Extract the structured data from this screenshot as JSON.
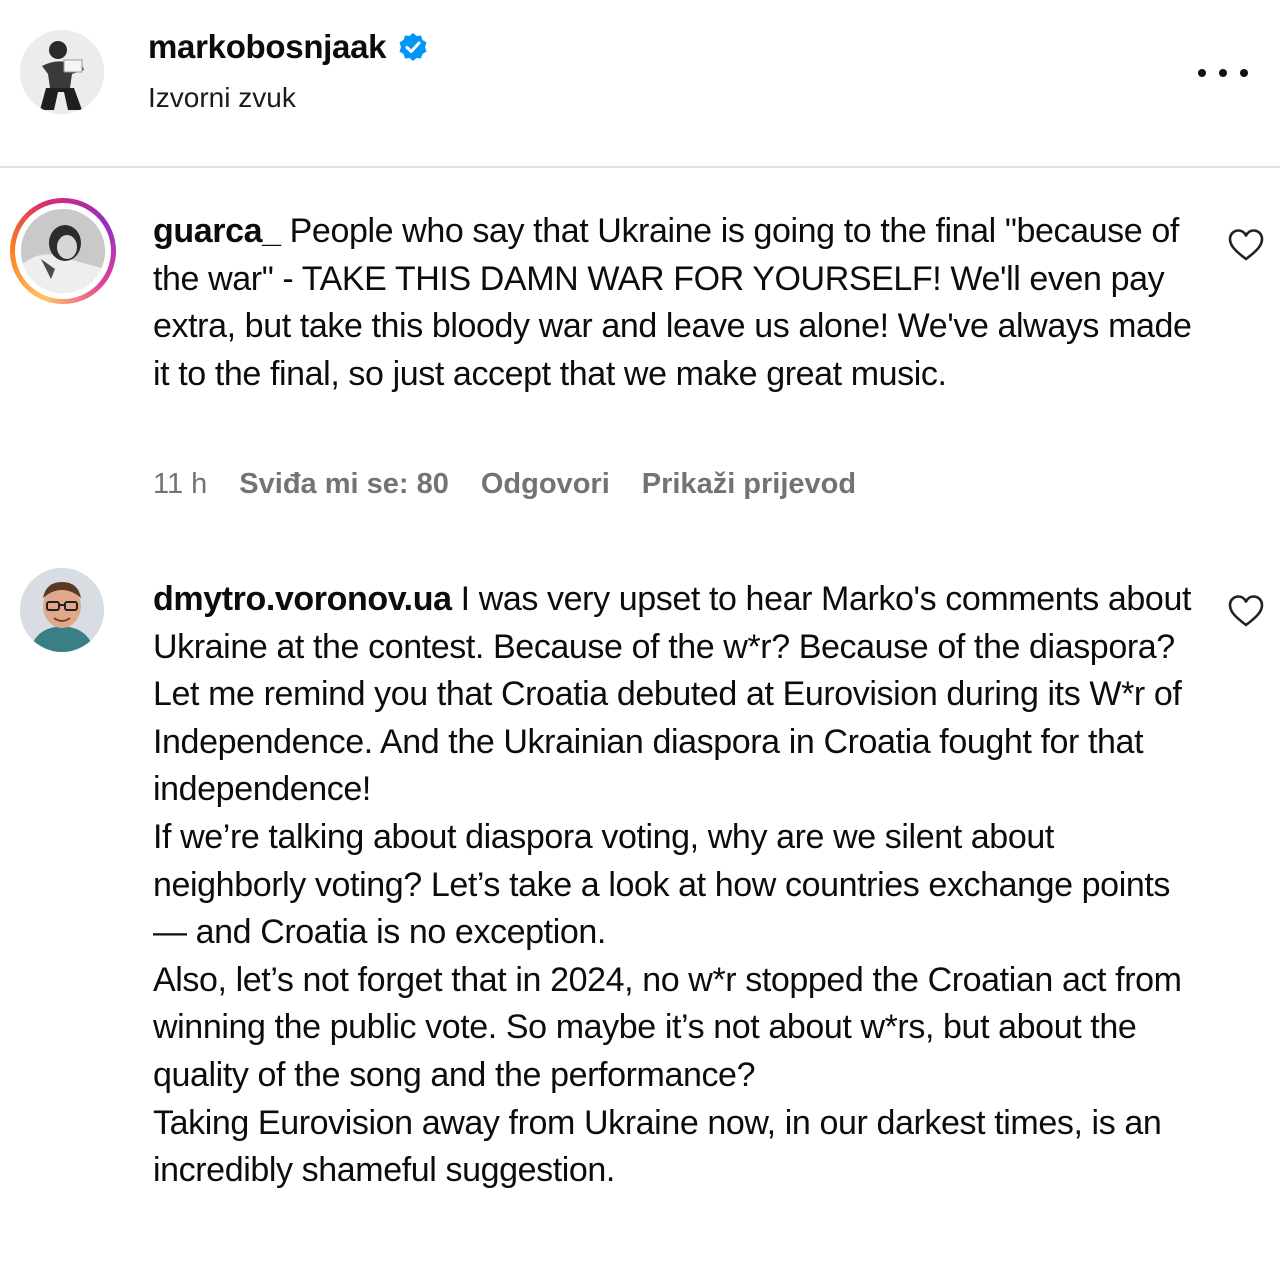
{
  "post": {
    "username": "markobosnjaak",
    "subtitle": "Izvorni zvuk"
  },
  "comments": [
    {
      "username": "guarca_",
      "text": "People who say that Ukraine is going to the final \"because of the war\" - TAKE THIS DAMN WAR FOR YOURSELF! We'll even pay extra, but take this bloody war and leave us alone! We've always made it to the final, so just accept that we make great music.",
      "time": "11 h",
      "likes": "Sviđa mi se: 80",
      "reply": "Odgovori",
      "translate": "Prikaži prijevod"
    },
    {
      "username": "dmytro.voronov.ua",
      "text": "I was very upset to hear Marko's comments about Ukraine at the contest. Because of the w*r? Because of the diaspora?\nLet me remind you that Croatia debuted at Eurovision during its W*r of Independence. And the Ukrainian diaspora in Croatia fought for that independence!\nIf we’re talking about diaspora voting, why are we silent about neighborly voting? Let’s take a look at how countries exchange points — and Croatia is no exception.\nAlso, let’s not forget that in 2024, no w*r stopped the Croatian act from winning the public vote. So maybe it’s not about w*rs, but about the quality of the song and the performance?\nTaking Eurovision away from Ukraine now, in our darkest times, is an incredibly shameful suggestion."
    }
  ],
  "icons": {
    "verified": "verified-badge-icon",
    "more": "more-options-icon",
    "like": "heart-outline-icon"
  },
  "colors": {
    "verified": "#0095f6",
    "meta_text": "#737373",
    "text": "#0c0c0c"
  }
}
